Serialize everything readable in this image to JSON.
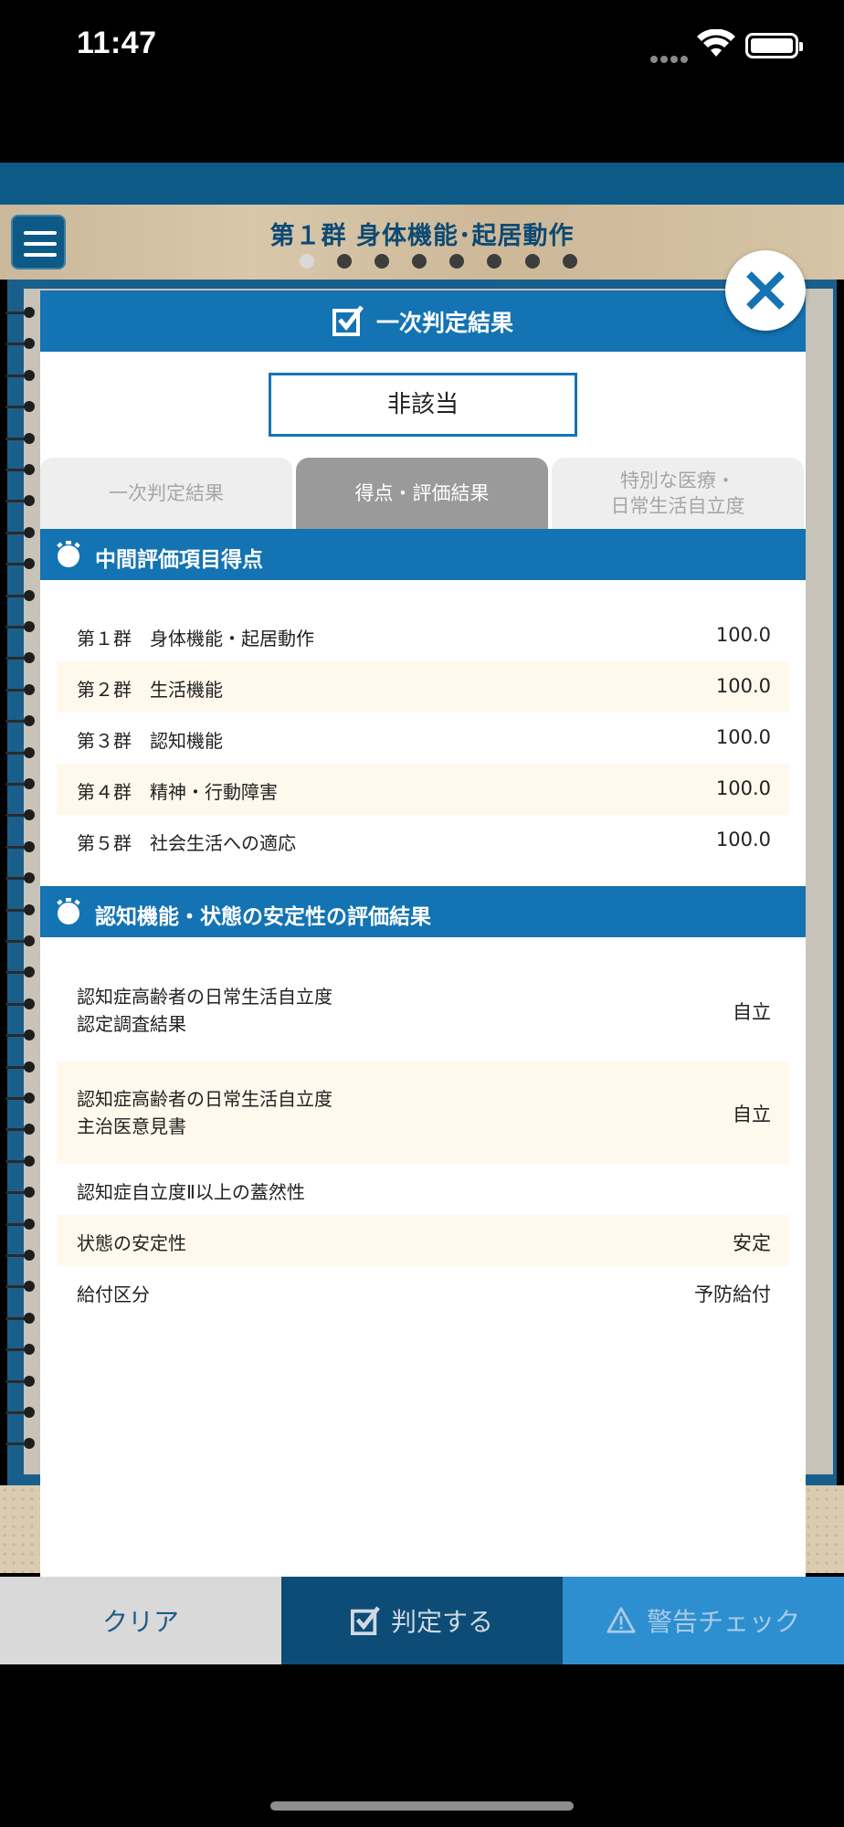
{
  "status_bar": {
    "time": "11:47"
  },
  "header": {
    "title": "第１群 身体機能･起居動作",
    "page_count": 8,
    "active_page": 1
  },
  "modal": {
    "title": "一次判定結果",
    "result": "非該当",
    "tabs": [
      {
        "label": "一次判定結果"
      },
      {
        "label": "得点・評価結果"
      },
      {
        "label": "特別な医療・\n日常生活自立度"
      }
    ],
    "active_tab": 2,
    "sections": {
      "scores": {
        "title": "中間評価項目得点",
        "rows": [
          {
            "label": "第１群　身体機能・起居動作",
            "value": "100.0"
          },
          {
            "label": "第２群　生活機能",
            "value": "100.0"
          },
          {
            "label": "第３群　認知機能",
            "value": "100.0"
          },
          {
            "label": "第４群　精神・行動障害",
            "value": "100.0"
          },
          {
            "label": "第５群　社会生活への適応",
            "value": "100.0"
          }
        ]
      },
      "stability": {
        "title": "認知機能・状態の安定性の評価結果",
        "rows": [
          {
            "label": "認知症高齢者の日常生活自立度\n認定調査結果",
            "value": "自立"
          },
          {
            "label": "認知症高齢者の日常生活自立度\n主治医意見書",
            "value": "自立"
          },
          {
            "label": "認知症自立度Ⅱ以上の蓋然性",
            "value": ""
          },
          {
            "label": "状態の安定性",
            "value": "安定"
          },
          {
            "label": "給付区分",
            "value": "予防給付"
          }
        ]
      }
    }
  },
  "toolbar": {
    "clear_label": "クリア",
    "judge_label": "判定する",
    "warning_label": "警告チェック"
  },
  "colors": {
    "primary_blue": "#1473b3",
    "dark_blue": "#0c4c76",
    "light_blue": "#2d8fd0",
    "row_highlight": "#fef9ec"
  }
}
